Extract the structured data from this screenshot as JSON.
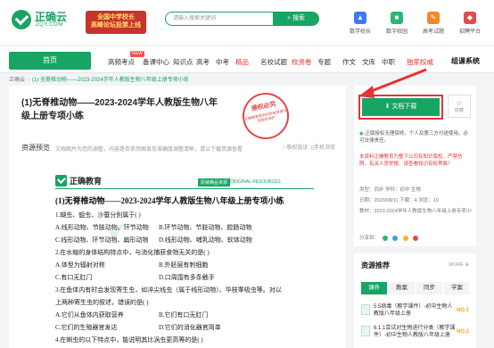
{
  "header": {
    "logo_name": "正确云",
    "logo_sub": "ZQY.COM",
    "promo": "全国中学校长\n高峰论坛投票上线",
    "search_placeholder": "请输入搜索关键词",
    "search_button": "搜索",
    "icons": [
      {
        "label": "数学校长",
        "icon": "chart-icon",
        "color": "#3d7cf0"
      },
      {
        "label": "数字校园",
        "icon": "campus-icon",
        "color": "#2bb673"
      },
      {
        "label": "高考试题",
        "icon": "exam-icon",
        "color": "#f08a24"
      },
      {
        "label": "招聘平台",
        "icon": "briefcase-icon",
        "color": "#e24b4b"
      }
    ]
  },
  "nav": {
    "home": "首页",
    "items": [
      {
        "label": "高频考点",
        "tag": "NEW"
      },
      {
        "label": "备课中心"
      },
      {
        "label": "知识点"
      },
      {
        "label": "高考"
      },
      {
        "label": "中考"
      },
      {
        "label": "精品",
        "red": true
      },
      {
        "label": "名校试题"
      },
      {
        "label": "校资卷",
        "red": true
      },
      {
        "label": "专题"
      },
      {
        "label": "作文"
      },
      {
        "label": "文库"
      },
      {
        "label": "中职"
      },
      {
        "label": "独家权威",
        "red": true
      }
    ],
    "special": "组课系统"
  },
  "breadcrumb": {
    "items": [
      "正确云",
      "(1) 无脊椎动物——2023-2024学年人教版生物八年级上册专项小练"
    ]
  },
  "main": {
    "title": "(1)无脊椎动物——2023-2024学年人教版生物八年级上册专项小练",
    "stamp_title": "侵权必究",
    "stamp_text": "正确教育提供的所有资源均受版权保护",
    "preview_label": "资源预览",
    "preview_hint": "文档图片为您的调整，内容是否依然图显及准确度调整清晰，请以下载资源查看原始文档内容。",
    "report_label": "版权投诉",
    "mobile_label": "手机浏览"
  },
  "document": {
    "brand": "正确教育",
    "brand_tag": "原装精品资源",
    "brand_tag2": "ORIGINAL RESOURCES",
    "sheet_title": "(1)无脊椎动物——2023-2024学年人教版生物八年级上册专项小练",
    "lines": [
      {
        "a": "1.蝴虫、蛆虫、沙蚕分别属于(    )"
      },
      {
        "a": "A.线形动物、节肢动物、环节动物",
        "b": "B.环节动物、节肢动物、腔肠动物"
      },
      {
        "a": "C.线形动物、环节动物、扁形动物",
        "b": "D.线形动物、哺乳动物、软体动物"
      },
      {
        "a": "2.在水螅的身体结构特点中，与消化捕获食物无关的是(    )"
      },
      {
        "a": "A.体型为辐射对称",
        "b": "B.外胚层有刺细胞"
      },
      {
        "a": "C.有口无肛门",
        "b": "D.口周围有多条触手"
      },
      {
        "a": "3.在鱼体内有时会发现寄生虫，如淬尖线虫（属于线形动物）、华枝睾吸虫等。对以"
      },
      {
        "a": "上两种寄生虫的叙述，错误的是(    )"
      },
      {
        "a": "A.它们从鱼体内获取营养",
        "b": "B.它们有口无肛门"
      },
      {
        "a": "C.它们的生殖器官发达",
        "b": "D.它们的消化器官简单"
      },
      {
        "a": "4.在蝌虫的以下特点中，能说明其比涡虫更高等的是(    )"
      }
    ]
  },
  "side": {
    "download": "文档下载",
    "favorite": "收藏",
    "note": "正版授权无理保修，个人及第三方付送使用。必可法律责任。",
    "warn": "本资料正确教育为整下公司有知识版权，严禁仿照，有关人员举报、请查看知识有权界面！",
    "meta": [
      "类型：同步    学科：初中 生物",
      "日期：2023/08/11    下载：4    浏览：19",
      "教材：2023-2024学年人教版生物八年级上册专项小练"
    ],
    "share": "分享到："
  },
  "recommend": {
    "title": "资源推荐",
    "more": "MORE",
    "tabs": [
      "课件",
      "教案",
      "同步",
      "学案"
    ],
    "active_tab": 0,
    "items": [
      {
        "text": "5.5病毒（教学课件）-初中生物人教版八年级上册",
        "rank": "NO.1"
      },
      {
        "text": "6.1.1尝试对生物进行分类（教学课件）-初中生物人教版八年级上册",
        "rank": "NO.2"
      }
    ]
  },
  "colors": {
    "brand": "#17a564",
    "accent_red": "#e53333"
  }
}
